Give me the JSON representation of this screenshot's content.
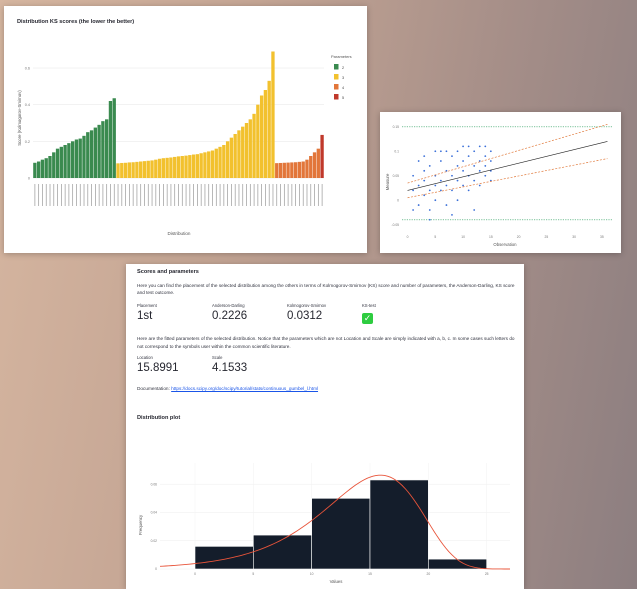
{
  "ks_chart": {
    "title": "Distribution KS scores (the lower the better)",
    "ylabel": "Score (Kolmogorov-Smirnov)",
    "xlabel": "Distribution",
    "legend_title": "Parameters",
    "legend": [
      {
        "label": "2",
        "color": "#3a8a4f"
      },
      {
        "label": "3",
        "color": "#f2c12e"
      },
      {
        "label": "4",
        "color": "#e2763a"
      },
      {
        "label": "5",
        "color": "#c0392b"
      }
    ],
    "yticks": [
      "0",
      "0.2",
      "0.4",
      "0.6"
    ],
    "colors": [
      "#3a8a4f",
      "#f2c12e",
      "#e2763a",
      "#c0392b"
    ]
  },
  "chart_data": [
    {
      "type": "bar",
      "title": "Distribution KS scores (the lower the better)",
      "xlabel": "Distribution",
      "ylabel": "Score (Kolmogorov-Smirnov)",
      "ylim": [
        0,
        0.72
      ],
      "legend_position": "top-right",
      "series": [
        {
          "name": "2",
          "values": [
            0.083,
            0.09,
            0.1,
            0.108,
            0.12,
            0.14,
            0.16,
            0.17,
            0.18,
            0.19,
            0.2,
            0.21,
            0.215,
            0.23,
            0.25,
            0.26,
            0.275,
            0.29,
            0.31,
            0.32,
            0.42,
            0.435
          ]
        },
        {
          "name": "3",
          "values": [
            0.08,
            0.082,
            0.083,
            0.085,
            0.086,
            0.088,
            0.09,
            0.092,
            0.094,
            0.096,
            0.1,
            0.105,
            0.108,
            0.11,
            0.112,
            0.115,
            0.118,
            0.12,
            0.122,
            0.125,
            0.128,
            0.13,
            0.135,
            0.14,
            0.145,
            0.15,
            0.16,
            0.17,
            0.18,
            0.2,
            0.22,
            0.24,
            0.26,
            0.28,
            0.3,
            0.32,
            0.35,
            0.4,
            0.45,
            0.48,
            0.53,
            0.69
          ]
        },
        {
          "name": "4",
          "values": [
            0.081,
            0.082,
            0.083,
            0.084,
            0.085,
            0.086,
            0.088,
            0.09,
            0.1,
            0.12,
            0.14,
            0.16
          ]
        },
        {
          "name": "5",
          "values": [
            0.235
          ]
        }
      ]
    },
    {
      "type": "scatter",
      "xlabel": "Observation",
      "ylabel": "Measure",
      "x_ticks": [
        "0",
        "5",
        "10",
        "15",
        "20",
        "25",
        "30",
        "35"
      ],
      "y_ticks": [
        "-0.05",
        "0",
        "0.05",
        "0.1",
        "0.15"
      ],
      "xlim": [
        -1,
        37
      ],
      "ylim": [
        -0.065,
        0.17
      ],
      "reference_lines": [
        0.15,
        -0.04
      ],
      "fit": {
        "x0": 0,
        "y0": 0.02,
        "x1": 36,
        "y1": 0.12
      },
      "band_upper": {
        "x0": 0,
        "y0": 0.035,
        "x1": 36,
        "y1": 0.155
      },
      "band_lower": {
        "x0": 0,
        "y0": 0.005,
        "x1": 36,
        "y1": 0.085
      },
      "points": [
        [
          1,
          0.02
        ],
        [
          1,
          0.05
        ],
        [
          2,
          0.03
        ],
        [
          2,
          -0.01
        ],
        [
          3,
          0.04
        ],
        [
          3,
          0.06
        ],
        [
          3,
          0.01
        ],
        [
          4,
          0.02
        ],
        [
          4,
          0.07
        ],
        [
          4,
          -0.02
        ],
        [
          5,
          0.03
        ],
        [
          5,
          0.05
        ],
        [
          5,
          0.0
        ],
        [
          6,
          0.04
        ],
        [
          6,
          0.08
        ],
        [
          6,
          0.02
        ],
        [
          7,
          0.06
        ],
        [
          7,
          0.03
        ],
        [
          7,
          -0.01
        ],
        [
          8,
          0.05
        ],
        [
          8,
          0.09
        ],
        [
          8,
          0.02
        ],
        [
          9,
          0.04
        ],
        [
          9,
          0.07
        ],
        [
          9,
          0.0
        ],
        [
          10,
          0.06
        ],
        [
          10,
          0.03
        ],
        [
          10,
          0.08
        ],
        [
          11,
          0.05
        ],
        [
          11,
          0.09
        ],
        [
          11,
          0.02
        ],
        [
          12,
          0.07
        ],
        [
          12,
          0.04
        ],
        [
          12,
          0.1
        ],
        [
          13,
          0.06
        ],
        [
          13,
          0.08
        ],
        [
          13,
          0.03
        ],
        [
          14,
          0.07
        ],
        [
          14,
          0.09
        ],
        [
          14,
          0.05
        ],
        [
          15,
          0.08
        ],
        [
          15,
          0.06
        ],
        [
          15,
          0.1
        ],
        [
          2,
          0.08
        ],
        [
          4,
          -0.04
        ],
        [
          6,
          0.1
        ],
        [
          8,
          -0.03
        ],
        [
          10,
          0.11
        ],
        [
          12,
          -0.02
        ],
        [
          14,
          0.11
        ],
        [
          1,
          -0.02
        ],
        [
          3,
          0.09
        ],
        [
          5,
          0.1
        ],
        [
          7,
          0.1
        ],
        [
          9,
          0.1
        ],
        [
          11,
          0.11
        ],
        [
          13,
          0.11
        ],
        [
          15,
          0.04
        ]
      ]
    },
    {
      "type": "bar",
      "title": "Distribution plot",
      "xlabel": "Values",
      "ylabel": "Frequency",
      "xlim": [
        -3,
        27
      ],
      "ylim": [
        0,
        0.075
      ],
      "x_ticks": [
        "0",
        "5",
        "10",
        "15",
        "20",
        "25"
      ],
      "y_ticks": [
        "0",
        "0.02",
        "0.04",
        "0.06"
      ],
      "bins": [
        [
          0,
          5,
          0.016
        ],
        [
          5,
          10,
          0.024
        ],
        [
          10,
          15,
          0.05
        ],
        [
          15,
          20,
          0.063
        ],
        [
          20,
          25,
          0.007
        ]
      ],
      "pdf_location": 15.8991,
      "pdf_scale": 4.1533
    }
  ],
  "results": {
    "heading": "Scores and parameters",
    "intro": "Here you can find the placement of the selected distribution among the others in terms of Kolmogorov-Smirnov (KS) score and number of parameters, the Anderson-Darling, KS score and test outcome.",
    "placement_label": "Placement",
    "placement_value": "1st",
    "ad_label": "Anderson-Darling",
    "ad_value": "0.2226",
    "ks_label": "Kolmogorov-Smirnov",
    "ks_value": "0.0312",
    "kstest_label": "KS-test",
    "kstest_value": "✓",
    "params_text": "Here are the fitted parameters of the selected distribution. Notice that the parameters which are not Location and Scale are simply indicated with a, b, c. In some cases such letters do not correspond to the symbols user within the common scientific literature.",
    "location_label": "Location",
    "location_value": "15.8991",
    "scale_label": "Scale",
    "scale_value": "4.1533",
    "doc_label": "Documentation:",
    "doc_link": "https://docs.scipy.org/doc/scipy/tutorial/stats/continuous_gumbel_l.html",
    "dist_heading": "Distribution plot"
  }
}
